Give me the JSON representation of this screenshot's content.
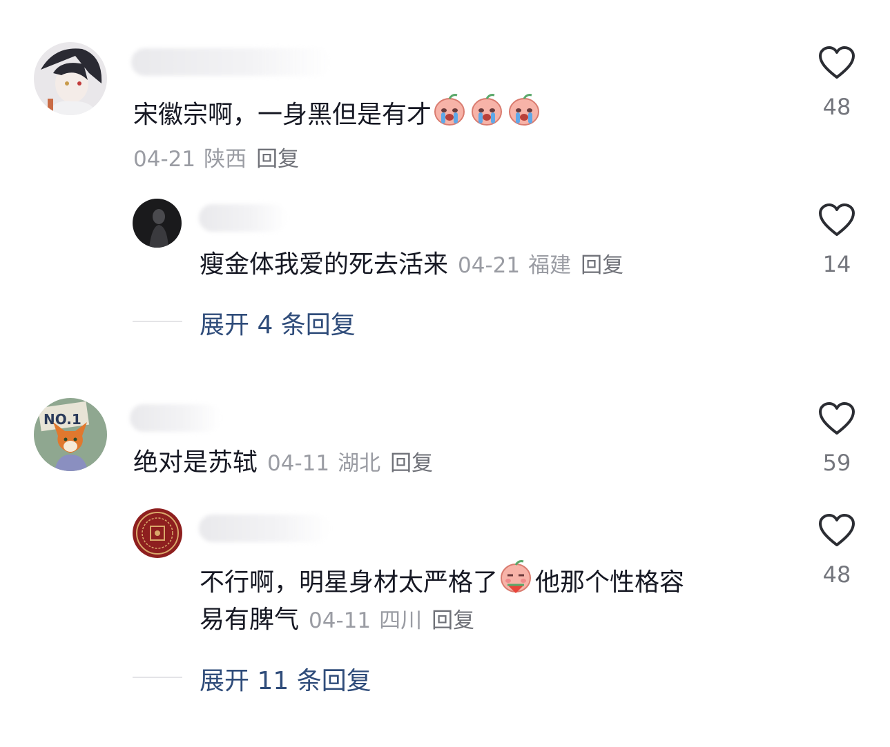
{
  "comments": [
    {
      "text": "宋徽宗啊，一身黑但是有才",
      "emoji": [
        "crying-peach-emoji",
        "crying-peach-emoji",
        "crying-peach-emoji"
      ],
      "date": "04-21",
      "location": "陕西",
      "reply_label": "回复",
      "likes": "48",
      "replies": [
        {
          "text": "瘦金体我爱的死去活来",
          "date": "04-21",
          "location": "福建",
          "reply_label": "回复",
          "likes": "14"
        }
      ],
      "expand_label": "展开 4 条回复"
    },
    {
      "text": "绝对是苏轼",
      "date": "04-11",
      "location": "湖北",
      "reply_label": "回复",
      "likes": "59",
      "replies": [
        {
          "text_line1": "不行啊，明星身材太严格了",
          "emoji": "watermelon-peach-emoji",
          "text_line1_after": "他那个性格容",
          "text_line2": "易有脾气",
          "date": "04-11",
          "location": "四川",
          "reply_label": "回复",
          "likes": "48"
        }
      ],
      "expand_label": "展开 11 条回复"
    }
  ],
  "icons": {
    "like": "heart-outline-icon"
  },
  "colors": {
    "text": "#161823",
    "meta": "#9a9ca3",
    "link": "#2f4c7a",
    "icon": "#2b2d33"
  }
}
